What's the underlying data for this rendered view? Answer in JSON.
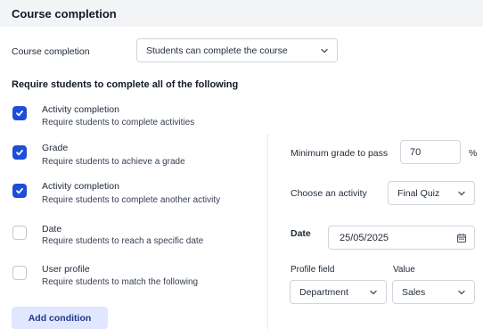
{
  "header": {
    "title": "Course completion"
  },
  "completion": {
    "label": "Course completion",
    "select_value": "Students can complete the course"
  },
  "requirements_heading": "Require students to complete all of the following",
  "conditions": [
    {
      "title": "Activity completion",
      "description": "Require students to complete activities",
      "checked": true
    },
    {
      "title": "Grade",
      "description": "Require students to achieve a grade",
      "checked": true
    },
    {
      "title": "Activity completion",
      "description": "Require students to complete another activity",
      "checked": true
    },
    {
      "title": "Date",
      "description": "Require students to reach a specific date",
      "checked": false
    },
    {
      "title": "User profile",
      "description": "Require students to match the following",
      "checked": false
    }
  ],
  "grade": {
    "label": "Minimum grade to pass",
    "value": "70",
    "unit": "%"
  },
  "activity": {
    "label": "Choose an activity",
    "value": "Final Quiz"
  },
  "date": {
    "label": "Date",
    "value": "25/05/2025"
  },
  "profile": {
    "field_label": "Profile field",
    "value_label": "Value",
    "field_value": "Department",
    "value_value": "Sales"
  },
  "add_condition_label": "Add condition",
  "colors": {
    "accent": "#1d4ed8",
    "header_bg": "#f3f4f6",
    "button_bg": "#e0e7ff"
  },
  "icons": {
    "dropdown": "chevron-down-icon",
    "checkbox": "check-icon",
    "date": "calendar-icon"
  }
}
